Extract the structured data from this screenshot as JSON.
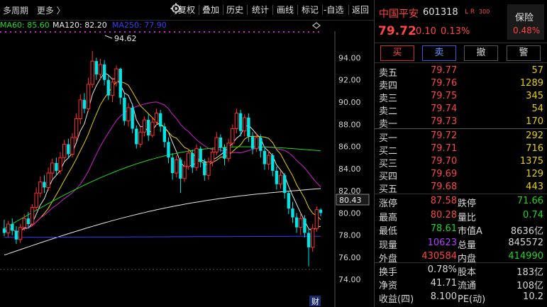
{
  "toolbar": {
    "period": "多周期",
    "more": "更多 〉",
    "buttons": [
      "复权",
      "叠加",
      "历史",
      "统计",
      "画线",
      "标记",
      "-自选",
      "返回"
    ]
  },
  "ma_legend": [
    {
      "label": "MA60: 85.60",
      "color": "#1ddc1d"
    },
    {
      "label": "MA120: 82.20",
      "color": "#e8e8e8"
    },
    {
      "label": "MA250: 77.90",
      "color": "#3a3aff"
    }
  ],
  "chart": {
    "y_ticks": [
      "94.00",
      "92.00",
      "90.00",
      "88.00",
      "86.00",
      "84.00",
      "82.00",
      "80.00",
      "78.00",
      "76.00",
      "74.00"
    ],
    "high_annotation": "94.62",
    "current_price_tag": "80.43",
    "earnings_marker": "财"
  },
  "chart_data": {
    "type": "candlestick",
    "ylim": [
      73.5,
      95.5
    ],
    "high_label": 94.62,
    "last_price": 80.43,
    "ma_lines": [
      {
        "name": "MA60",
        "last": 85.6,
        "color": "#1ddc1d"
      },
      {
        "name": "MA120",
        "last": 82.2,
        "color": "#e8e8e8"
      },
      {
        "name": "MA250",
        "last": 77.9,
        "color": "#3a3aff"
      }
    ],
    "candles": [
      [
        78.6,
        78.2,
        79.4,
        77.9
      ],
      [
        78.2,
        79.0,
        79.3,
        77.8
      ],
      [
        79.0,
        78.4,
        79.5,
        78.0
      ],
      [
        78.4,
        77.6,
        78.8,
        77.2
      ],
      [
        77.6,
        78.7,
        79.0,
        77.3
      ],
      [
        78.7,
        79.5,
        79.9,
        78.4
      ],
      [
        79.5,
        79.0,
        80.1,
        78.6
      ],
      [
        79.0,
        80.5,
        80.8,
        78.8
      ],
      [
        80.5,
        81.8,
        82.3,
        80.2
      ],
      [
        81.8,
        82.8,
        83.3,
        81.4
      ],
      [
        82.8,
        82.3,
        83.4,
        81.8
      ],
      [
        82.3,
        83.6,
        84.1,
        82.0
      ],
      [
        83.6,
        84.5,
        84.9,
        83.1
      ],
      [
        84.5,
        83.8,
        85.0,
        83.4
      ],
      [
        83.8,
        85.0,
        85.5,
        83.5
      ],
      [
        85.0,
        86.2,
        86.6,
        84.7
      ],
      [
        86.2,
        85.3,
        86.7,
        84.9
      ],
      [
        85.3,
        86.8,
        87.2,
        85.0
      ],
      [
        86.8,
        88.5,
        89.0,
        86.5
      ],
      [
        88.5,
        90.2,
        90.7,
        88.0
      ],
      [
        90.2,
        89.4,
        90.8,
        89.0
      ],
      [
        89.4,
        91.6,
        92.2,
        89.1
      ],
      [
        91.6,
        93.7,
        94.62,
        91.3
      ],
      [
        93.7,
        92.5,
        94.0,
        92.0
      ],
      [
        92.5,
        93.4,
        93.9,
        92.0
      ],
      [
        93.4,
        92.0,
        93.8,
        91.5
      ],
      [
        92.0,
        90.6,
        92.4,
        90.2
      ],
      [
        90.6,
        91.8,
        92.2,
        90.0
      ],
      [
        91.8,
        93.0,
        93.3,
        91.4
      ],
      [
        93.0,
        90.4,
        93.1,
        89.8
      ],
      [
        90.4,
        88.3,
        90.8,
        87.9
      ],
      [
        88.3,
        89.5,
        89.9,
        87.8
      ],
      [
        89.5,
        87.6,
        89.8,
        87.2
      ],
      [
        87.6,
        86.2,
        87.9,
        85.8
      ],
      [
        86.2,
        87.3,
        87.8,
        85.9
      ],
      [
        87.3,
        88.4,
        88.7,
        86.9
      ],
      [
        88.4,
        87.0,
        88.9,
        86.5
      ],
      [
        87.0,
        88.2,
        88.6,
        86.8
      ],
      [
        88.2,
        89.0,
        89.4,
        87.9
      ],
      [
        89.0,
        87.8,
        89.3,
        87.3
      ],
      [
        87.8,
        86.4,
        88.1,
        85.9
      ],
      [
        86.4,
        85.0,
        86.8,
        84.5
      ],
      [
        85.0,
        83.6,
        85.4,
        83.0
      ],
      [
        83.6,
        84.8,
        85.2,
        83.2
      ],
      [
        84.8,
        83.1,
        85.0,
        81.8
      ],
      [
        83.1,
        84.2,
        84.7,
        82.8
      ],
      [
        84.2,
        85.4,
        85.8,
        83.9
      ],
      [
        85.4,
        84.1,
        85.7,
        83.6
      ],
      [
        84.1,
        85.8,
        86.2,
        83.8
      ],
      [
        85.8,
        84.6,
        86.0,
        84.1
      ],
      [
        84.6,
        83.4,
        84.9,
        82.9
      ],
      [
        83.4,
        84.6,
        85.0,
        83.0
      ],
      [
        84.6,
        85.5,
        85.9,
        84.2
      ],
      [
        85.5,
        86.8,
        87.3,
        85.2
      ],
      [
        86.8,
        85.9,
        87.1,
        85.5
      ],
      [
        85.9,
        84.9,
        86.2,
        84.3
      ],
      [
        84.9,
        86.3,
        86.7,
        84.6
      ],
      [
        86.3,
        87.6,
        88.0,
        86.0
      ],
      [
        87.6,
        89.0,
        89.4,
        87.2
      ],
      [
        89.0,
        87.4,
        89.3,
        86.9
      ],
      [
        87.4,
        88.6,
        88.9,
        86.9
      ],
      [
        88.6,
        86.9,
        89.0,
        86.4
      ],
      [
        86.9,
        85.8,
        87.3,
        85.3
      ],
      [
        85.8,
        86.8,
        87.2,
        85.5
      ],
      [
        86.8,
        85.6,
        87.1,
        85.0
      ],
      [
        85.6,
        84.4,
        86.0,
        83.9
      ],
      [
        84.4,
        85.2,
        85.6,
        83.9
      ],
      [
        85.2,
        83.8,
        85.4,
        83.3
      ],
      [
        83.8,
        82.6,
        84.2,
        82.1
      ],
      [
        82.6,
        83.4,
        83.8,
        82.2
      ],
      [
        83.4,
        81.8,
        83.6,
        81.3
      ],
      [
        81.8,
        80.4,
        82.0,
        79.9
      ],
      [
        80.4,
        79.6,
        81.0,
        79.1
      ],
      [
        79.6,
        78.7,
        80.0,
        78.2
      ],
      [
        78.7,
        79.5,
        79.9,
        78.0
      ],
      [
        79.5,
        78.2,
        79.8,
        77.8
      ],
      [
        78.2,
        76.9,
        78.6,
        75.2
      ],
      [
        76.9,
        78.6,
        79.0,
        76.5
      ],
      [
        78.6,
        80.3,
        80.6,
        78.3
      ],
      [
        80.3,
        80.0,
        80.43,
        79.7
      ]
    ]
  },
  "stock": {
    "name": "中国平安",
    "code": "601318",
    "tags": "L R",
    "tag_sub": "300",
    "price": "79.72",
    "change": "0.10",
    "change_pct": "0.13%",
    "sector": "保险",
    "sector_pct": "0.48%"
  },
  "trade_buttons": [
    "买",
    "卖",
    "撤",
    "警"
  ],
  "asks": [
    {
      "label": "卖五",
      "price": "79.77",
      "vol": "57"
    },
    {
      "label": "卖四",
      "price": "79.76",
      "vol": "1289"
    },
    {
      "label": "卖三",
      "price": "79.75",
      "vol": "345"
    },
    {
      "label": "卖二",
      "price": "79.74",
      "vol": "54"
    },
    {
      "label": "卖一",
      "price": "79.73",
      "vol": "170"
    }
  ],
  "bids": [
    {
      "label": "买一",
      "price": "79.72",
      "vol": "292"
    },
    {
      "label": "买二",
      "price": "79.71",
      "vol": "716"
    },
    {
      "label": "买三",
      "price": "79.70",
      "vol": "1375"
    },
    {
      "label": "买四",
      "price": "79.69",
      "vol": "129"
    },
    {
      "label": "买五",
      "price": "79.68",
      "vol": "443"
    }
  ],
  "stats": {
    "rows": [
      [
        {
          "k": "涨停",
          "v": "87.58",
          "c": "#ff4545"
        },
        {
          "k": "跌停",
          "v": "71.66",
          "c": "#21d321"
        }
      ],
      [
        {
          "k": "最高",
          "v": "80.28",
          "c": "#ff4545"
        },
        {
          "k": "量比",
          "v": "0.74",
          "c": "#21d321"
        }
      ],
      [
        {
          "k": "最低",
          "v": "78.61",
          "c": "#21d321"
        },
        {
          "k": "市值A",
          "v": "8636亿",
          "c": "#d8d8d8"
        }
      ],
      [
        {
          "k": "现量",
          "v": "10623",
          "c": "#b040ff"
        },
        {
          "k": "总量",
          "v": "845572",
          "c": "#d8d8d8"
        }
      ],
      [
        {
          "k": "外盘",
          "v": "430584",
          "c": "#ff4545"
        },
        {
          "k": "内盘",
          "v": "414990",
          "c": "#21d321"
        }
      ]
    ],
    "rows2": [
      [
        {
          "k": "换手",
          "v": "0.78%",
          "c": "#d8d8d8"
        },
        {
          "k": "股本",
          "v": "183亿",
          "c": "#d8d8d8"
        }
      ],
      [
        {
          "k": "净资",
          "v": "41.71",
          "c": "#d8d8d8"
        },
        {
          "k": "流通",
          "v": "108亿",
          "c": "#d8d8d8"
        }
      ],
      [
        {
          "k": "收益(四)",
          "v": "8.100",
          "c": "#d8d8d8"
        },
        {
          "k": "PE(动)",
          "v": "10.2",
          "c": "#d8d8d8"
        }
      ]
    ]
  },
  "colors": {
    "up": "#ff3030",
    "down": "#00e6e6",
    "ask_vol": "#e8d000",
    "accent": "#ff4545"
  },
  "icons": [
    "gear-icon",
    "chevron-down-icon"
  ]
}
